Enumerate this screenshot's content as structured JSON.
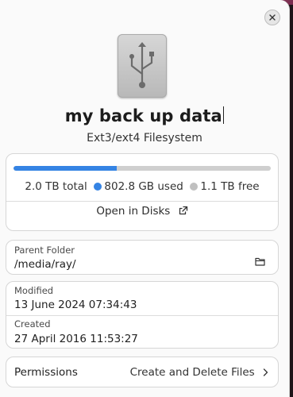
{
  "window": {
    "close_icon": "close-icon"
  },
  "drive": {
    "icon": "usb-drive-icon",
    "name": "my back up data",
    "filesystem": "Ext3/ext4 Filesystem"
  },
  "usage": {
    "used_fraction": 0.4,
    "total": "2.0 TB total",
    "used": "802.8 GB used",
    "free": "1.1 TB free",
    "colors": {
      "used": "#3584e4",
      "free": "#c0c0c0"
    },
    "open_label": "Open in Disks",
    "open_icon": "external-link-icon"
  },
  "parent": {
    "label": "Parent Folder",
    "path": "/media/ray/",
    "icon": "folder-icon"
  },
  "dates": {
    "modified_label": "Modified",
    "modified": "13 June 2024 07:34:43",
    "created_label": "Created",
    "created": "27 April 2016 11:53:27"
  },
  "permissions": {
    "label": "Permissions",
    "value": "Create and Delete Files",
    "icon": "chevron-right-icon"
  }
}
